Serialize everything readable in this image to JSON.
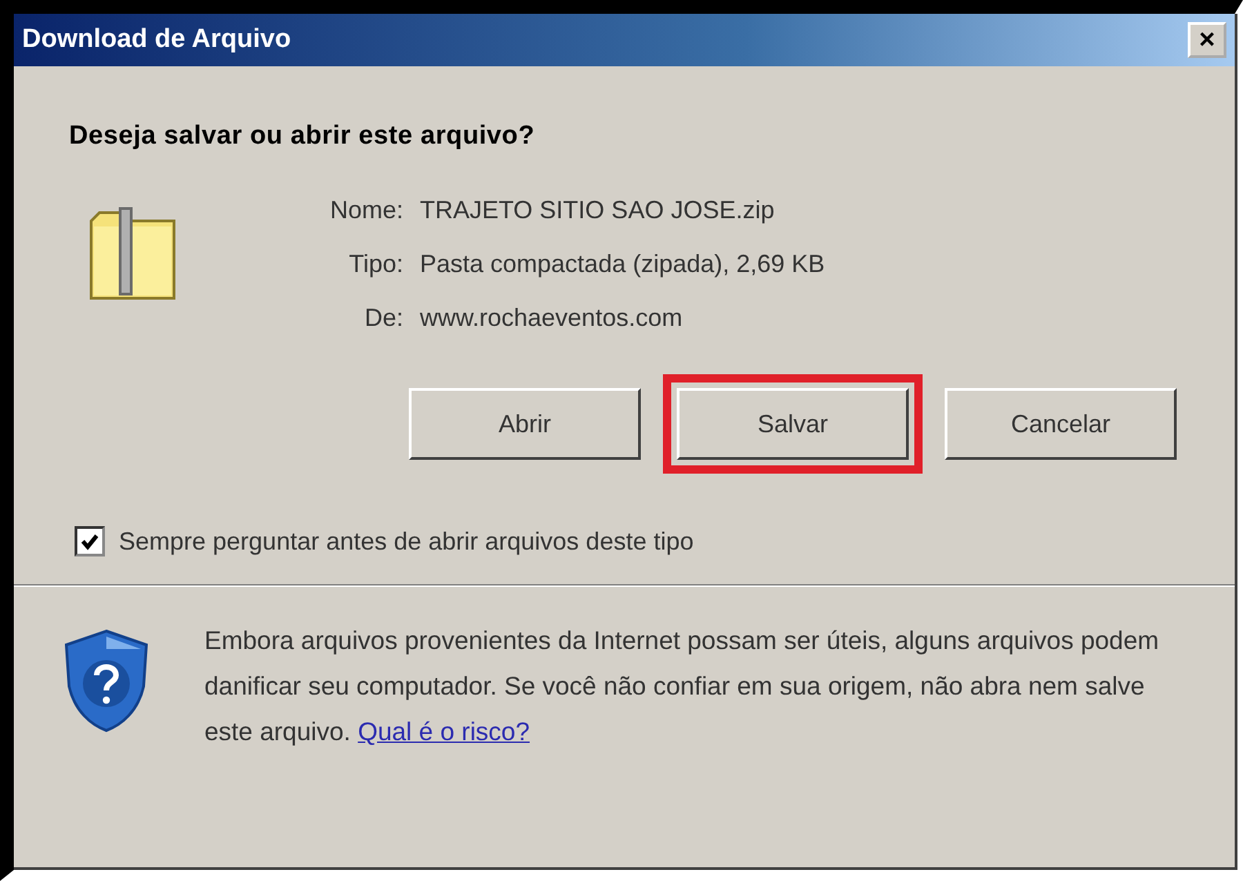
{
  "window": {
    "title": "Download de Arquivo",
    "close": "×"
  },
  "heading": "Deseja salvar ou abrir este arquivo?",
  "file_info": [
    {
      "label": "Nome:",
      "value": "TRAJETO SITIO SAO JOSE.zip"
    },
    {
      "label": "Tipo:",
      "value": "Pasta compactada (zipada), 2,69 KB"
    },
    {
      "label": "De:",
      "value": "www.rochaeventos.com"
    }
  ],
  "buttons": [
    {
      "label": "Abrir",
      "highlighted": false
    },
    {
      "label": "Salvar",
      "highlighted": true
    },
    {
      "label": "Cancelar",
      "highlighted": false
    }
  ],
  "always_ask": {
    "label": "Sempre perguntar antes de abrir arquivos deste tipo",
    "checked": true
  },
  "warning": {
    "text": "Embora arquivos provenientes da Internet possam ser úteis, alguns arquivos podem danificar seu computador. Se você não confiar em sua origem, não abra nem salve este arquivo.",
    "link": "Qual é o risco?"
  }
}
